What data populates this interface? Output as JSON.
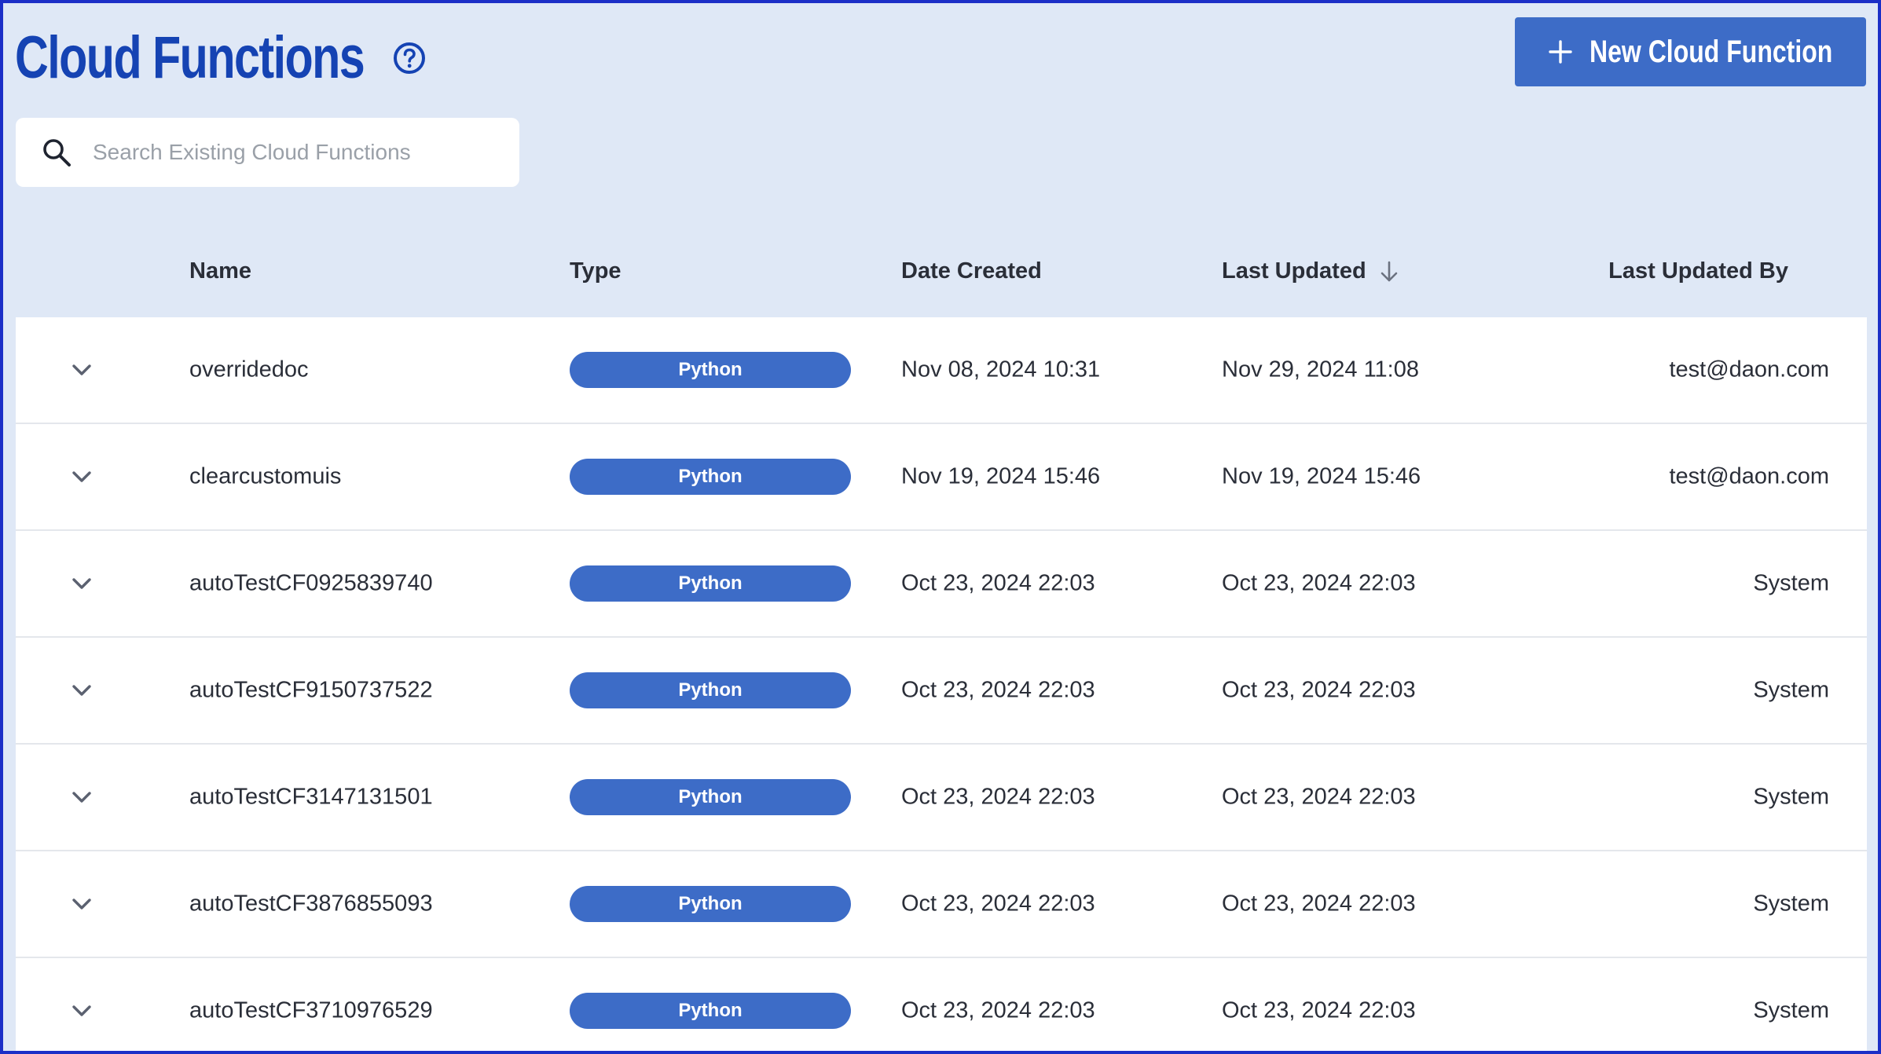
{
  "header": {
    "title": "Cloud Functions",
    "help_icon": "help-circle-icon",
    "new_button_label": "New Cloud Function",
    "new_button_icon": "plus-icon"
  },
  "search": {
    "placeholder": "Search Existing Cloud Functions",
    "value": "",
    "icon": "search-icon"
  },
  "table": {
    "columns": {
      "name": "Name",
      "type": "Type",
      "date_created": "Date Created",
      "last_updated": "Last Updated",
      "last_updated_by": "Last Updated By"
    },
    "sort": {
      "column": "last_updated",
      "direction": "descending",
      "icon": "arrow-down-icon"
    },
    "rows": [
      {
        "name": "overridedoc",
        "type": "Python",
        "date_created": "Nov 08, 2024 10:31",
        "last_updated": "Nov 29, 2024 11:08",
        "last_updated_by": "test@daon.com"
      },
      {
        "name": "clearcustomuis",
        "type": "Python",
        "date_created": "Nov 19, 2024 15:46",
        "last_updated": "Nov 19, 2024 15:46",
        "last_updated_by": "test@daon.com"
      },
      {
        "name": "autoTestCF0925839740",
        "type": "Python",
        "date_created": "Oct 23, 2024 22:03",
        "last_updated": "Oct 23, 2024 22:03",
        "last_updated_by": "System"
      },
      {
        "name": "autoTestCF9150737522",
        "type": "Python",
        "date_created": "Oct 23, 2024 22:03",
        "last_updated": "Oct 23, 2024 22:03",
        "last_updated_by": "System"
      },
      {
        "name": "autoTestCF3147131501",
        "type": "Python",
        "date_created": "Oct 23, 2024 22:03",
        "last_updated": "Oct 23, 2024 22:03",
        "last_updated_by": "System"
      },
      {
        "name": "autoTestCF3876855093",
        "type": "Python",
        "date_created": "Oct 23, 2024 22:03",
        "last_updated": "Oct 23, 2024 22:03",
        "last_updated_by": "System"
      },
      {
        "name": "autoTestCF3710976529",
        "type": "Python",
        "date_created": "Oct 23, 2024 22:03",
        "last_updated": "Oct 23, 2024 22:03",
        "last_updated_by": "System"
      }
    ]
  },
  "colors": {
    "title": "#1543b3",
    "accent": "#3d6cc7",
    "background": "#dfe8f6",
    "border": "#1c2fc7"
  }
}
